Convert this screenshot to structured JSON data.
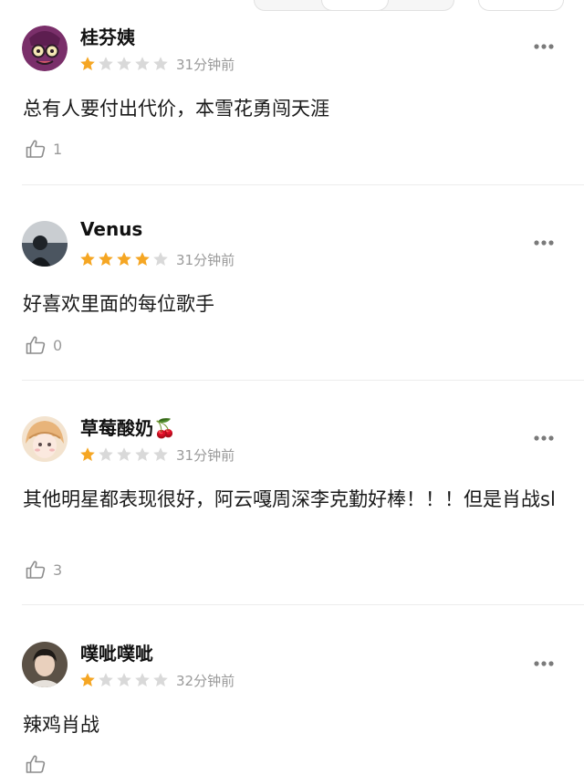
{
  "colors": {
    "star_filled": "#F5A623",
    "star_empty": "#D9D9D9",
    "muted_text": "#9A9A9A",
    "divider": "#ECECEC"
  },
  "reviews": [
    {
      "username": "桂芬姨",
      "rating": 1,
      "time": "31分钟前",
      "content": "总有人要付出代价，本雪花勇闯天涯",
      "likes": "1",
      "avatar_icon": "cartoon-face-avatar"
    },
    {
      "username": "Venus",
      "rating": 4,
      "time": "31分钟前",
      "content": "好喜欢里面的每位歌手",
      "likes": "0",
      "avatar_icon": "photo-avatar"
    },
    {
      "username": "草莓酸奶🍒",
      "rating": 1,
      "time": "31分钟前",
      "content": "其他明星都表现很好，阿云嘎周深李克勤好棒！！！但是肖战sl",
      "likes": "3",
      "avatar_icon": "anime-girl-avatar"
    },
    {
      "username": "噗呲噗呲",
      "rating": 1,
      "time": "32分钟前",
      "content": "辣鸡肖战",
      "likes": "",
      "avatar_icon": "photo-avatar"
    }
  ]
}
